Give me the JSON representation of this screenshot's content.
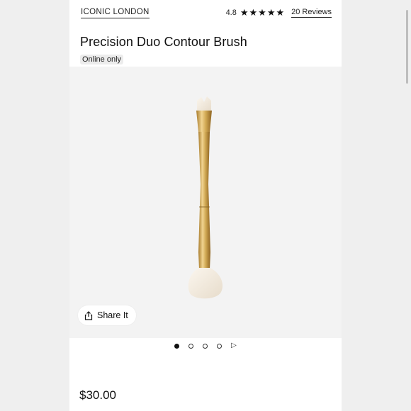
{
  "header": {
    "brand": "ICONIC LONDON",
    "rating": "4.8",
    "stars": 5,
    "reviews_label": "20 Reviews"
  },
  "product": {
    "title": "Precision Duo Contour Brush",
    "badge": "Online only",
    "price": "$30.00"
  },
  "share": {
    "label": "Share It"
  },
  "carousel": {
    "total_dots": 4,
    "active_index": 0
  },
  "colors": {
    "gold": "#c9a24a",
    "bristle": "#f2eadc",
    "background": "#efefef"
  }
}
